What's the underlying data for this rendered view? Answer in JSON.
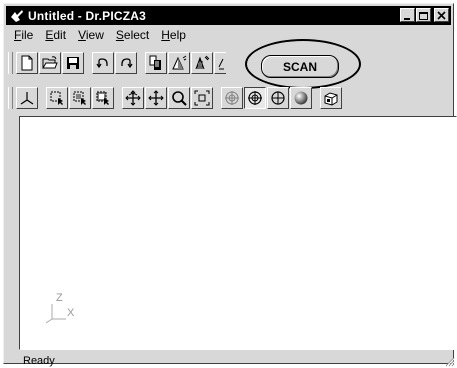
{
  "window": {
    "title": "Untitled - Dr.PICZA3",
    "controls": [
      "minimize",
      "maximize",
      "close"
    ]
  },
  "menu": [
    {
      "label": "File",
      "mnemonic": "F",
      "rest": "ile"
    },
    {
      "label": "Edit",
      "mnemonic": "E",
      "rest": "dit"
    },
    {
      "label": "View",
      "mnemonic": "V",
      "rest": "iew"
    },
    {
      "label": "Select",
      "mnemonic": "S",
      "rest": "elect"
    },
    {
      "label": "Help",
      "mnemonic": "H",
      "rest": "elp"
    }
  ],
  "toolbar1": {
    "icons": [
      "new-file-icon",
      "open-folder-icon",
      "save-icon",
      "undo-icon",
      "redo-icon",
      "copy-document-icon",
      "delta-icon",
      "scan-lines-icon",
      "edge-icon"
    ],
    "scan_label": "SCAN"
  },
  "toolbar2": {
    "icons": [
      "axis-view-icon",
      "select-region-icon",
      "select-region-add-icon",
      "select-region-sub-icon",
      "rotate-icon",
      "move-icon",
      "zoom-icon",
      "fit-icon",
      "target-icon",
      "target-crosshair-icon",
      "crosshair-circle-icon",
      "sphere-icon",
      "3d-view-icon"
    ]
  },
  "axis": {
    "z": "Z",
    "x": "X"
  },
  "status": {
    "text": "Ready"
  },
  "colors": {
    "titlebar": "#000000",
    "face": "#d8d8d8",
    "canvas": "#ffffff"
  }
}
